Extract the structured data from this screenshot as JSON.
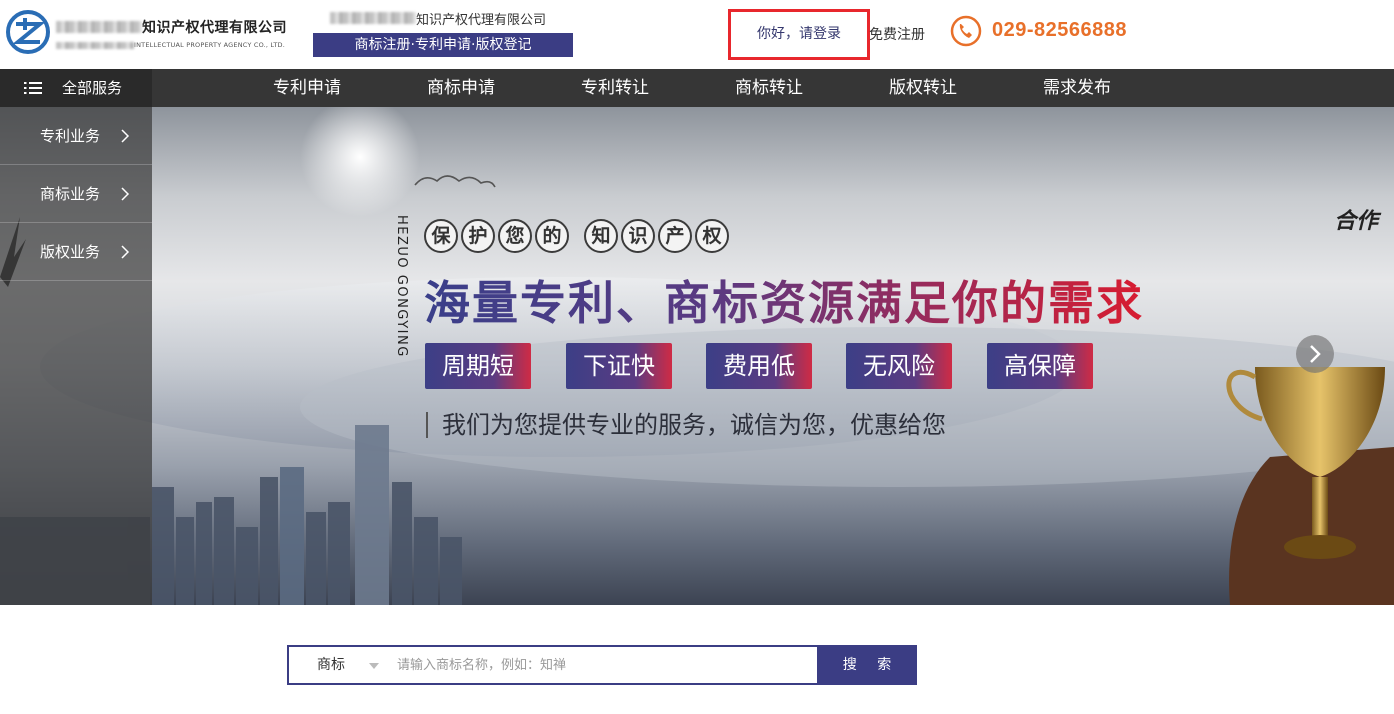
{
  "header": {
    "company_name": "知识产权代理有限公司",
    "company_name_en": "INTELLECTUAL PROPERTY AGENCY CO., LTD.",
    "slogan_top": "知识产权代理有限公司",
    "slogan_bar": "商标注册·专利申请·版权登记",
    "login": "你好，请登录",
    "register": "免费注册",
    "phone": "029-82566888",
    "accent_color": "#e8702a",
    "brand_color": "#3b3d84"
  },
  "nav": {
    "all_services": "全部服务",
    "items": [
      "专利申请",
      "商标申请",
      "专利转让",
      "商标转让",
      "版权转让",
      "需求发布"
    ]
  },
  "sidebar": {
    "items": [
      "专利业务",
      "商标业务",
      "版权业务"
    ]
  },
  "banner": {
    "vertical_text": "HEZUO GONGYING",
    "circle_chars_1": [
      "保",
      "护",
      "您",
      "的"
    ],
    "circle_chars_2": [
      "知",
      "识",
      "产",
      "权"
    ],
    "headline": "海量专利、商标资源满足你的需求",
    "tags": [
      "周期短",
      "下证快",
      "费用低",
      "无风险",
      "高保障"
    ],
    "tagline": "我们为您提供专业的服务，诚信为您，优惠给您",
    "corner_text": "合作"
  },
  "search": {
    "category": "商标",
    "placeholder": "请输入商标名称，例如：知禅",
    "button": "搜 索"
  }
}
